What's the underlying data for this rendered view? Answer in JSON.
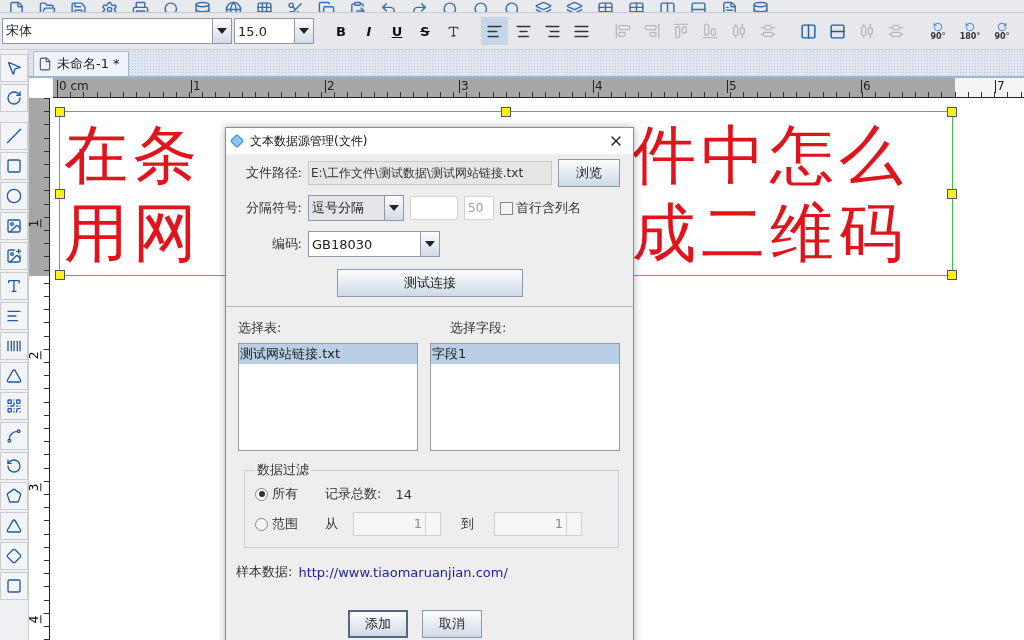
{
  "toolbar": {
    "font": "宋体",
    "size": "15.0",
    "format_buttons": [
      "B",
      "I",
      "U",
      "S"
    ],
    "align_buttons": [
      {
        "selected": true
      },
      {
        "selected": false
      },
      {
        "selected": false
      },
      {
        "selected": false
      }
    ],
    "rotate_buttons": [
      "90°",
      "180°",
      "90°"
    ]
  },
  "document_tab": {
    "title": "未命名-1 *"
  },
  "ruler": {
    "top_labels": [
      "0 cm",
      "1",
      "2",
      "3",
      "4",
      "5",
      "6",
      "7"
    ],
    "left_labels": [
      "1",
      "2",
      "3",
      "4"
    ]
  },
  "label": {
    "line_1": {
      "left": "在条",
      "right": "件中怎么"
    },
    "line_2": {
      "left": "用网",
      "right": "成二维码"
    }
  },
  "dialog": {
    "title": "文本数据源管理(文件)",
    "file_path": {
      "label": "文件路径:",
      "value": "E:\\工作文件\\测试数据\\测试网站链接.txt",
      "button": "浏览"
    },
    "delimiter": {
      "label": "分隔符号:",
      "value": "逗号分隔",
      "limit": "50",
      "header_row": {
        "label": "首行含列名",
        "checked": false
      }
    },
    "encoding": {
      "label": "编码:",
      "value": "GB18030"
    },
    "test_button": "测试连接",
    "tables": {
      "label": "选择表:",
      "items": [
        {
          "text": "测试网站链接.txt",
          "selected": true
        }
      ]
    },
    "fields": {
      "label": "选择字段:",
      "items": [
        {
          "text": "字段1",
          "selected": true
        }
      ]
    },
    "filter": {
      "title": "数据过滤",
      "options": [
        {
          "label": "所有",
          "selected": true
        },
        {
          "label": "范围",
          "selected": false
        }
      ],
      "total_label": "记录总数:",
      "total": "14",
      "from_label": "从",
      "from": "1",
      "to_label": "到",
      "to": "1"
    },
    "sample": {
      "label": "样本数据:",
      "value": "http://www.tiaomaruanjian.com/"
    },
    "buttons": [
      {
        "label": "添加",
        "default": true
      },
      {
        "label": "取消",
        "default": false
      }
    ]
  }
}
